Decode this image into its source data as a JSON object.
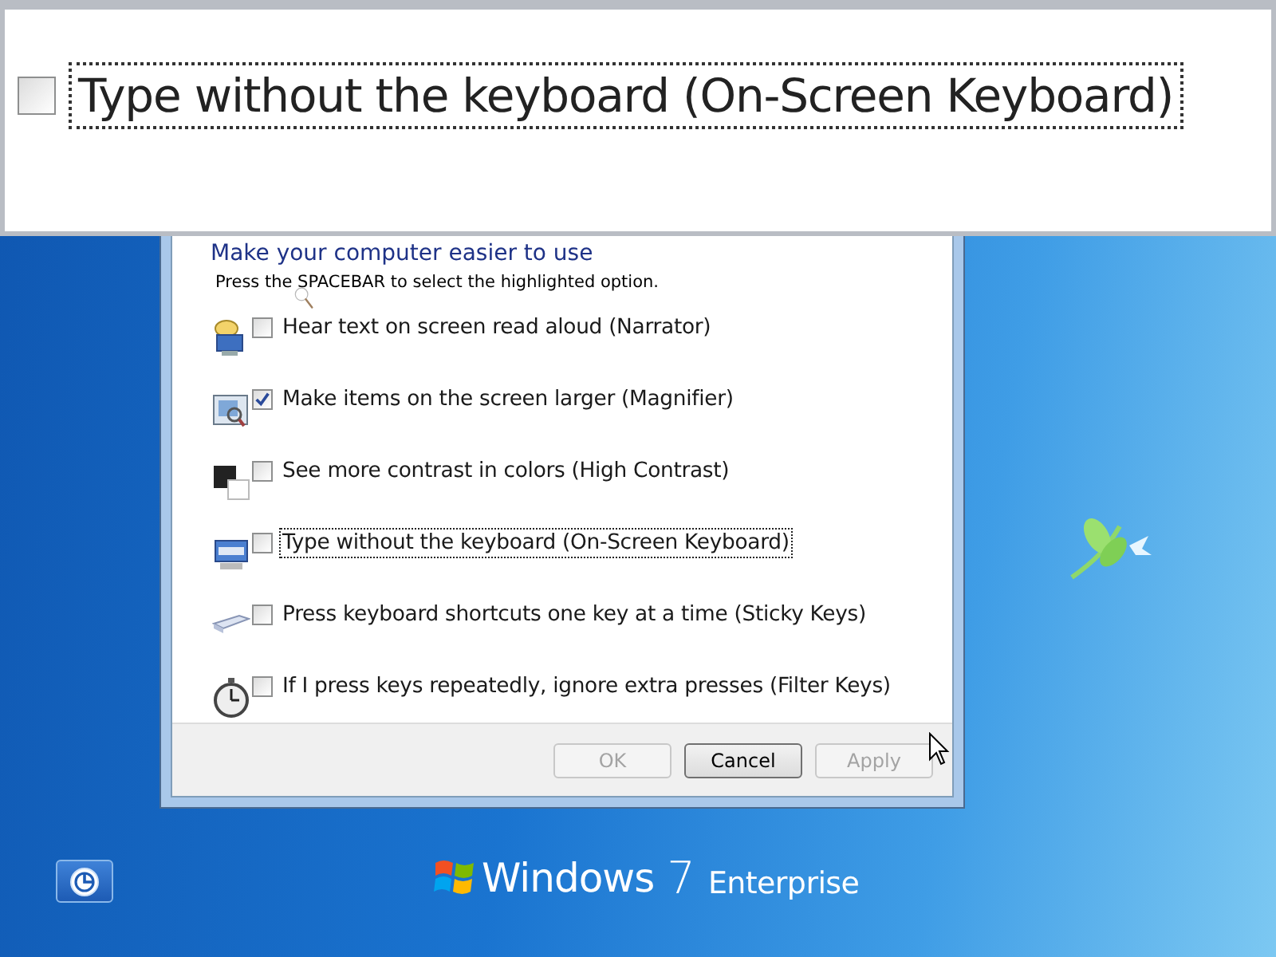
{
  "magnifier_view": {
    "option": {
      "label": "Type without the keyboard (On-Screen Keyboard)",
      "checked": false,
      "focused": true
    }
  },
  "dialog": {
    "heading": "Make your computer easier to use",
    "instruction": "Press the SPACEBAR to select the highlighted option.",
    "options": [
      {
        "kind": "narrator",
        "label": "Hear text on screen read aloud (Narrator)",
        "checked": false,
        "focused": false
      },
      {
        "kind": "magnifier",
        "label": "Make items on the screen larger (Magnifier)",
        "checked": true,
        "focused": false
      },
      {
        "kind": "contrast",
        "label": "See more contrast in colors (High Contrast)",
        "checked": false,
        "focused": false
      },
      {
        "kind": "keyboard",
        "label": "Type without the keyboard (On-Screen Keyboard)",
        "checked": false,
        "focused": true
      },
      {
        "kind": "sticky",
        "label": "Press keyboard shortcuts one key at a time (Sticky Keys)",
        "checked": false,
        "focused": false
      },
      {
        "kind": "filter",
        "label": "If I press keys repeatedly, ignore extra presses (Filter Keys)",
        "checked": false,
        "focused": false
      }
    ],
    "buttons": [
      {
        "label": "OK",
        "disabled": true
      },
      {
        "label": "Cancel",
        "disabled": false
      },
      {
        "label": "Apply",
        "disabled": true
      }
    ]
  },
  "branding": {
    "product": "Windows",
    "version": "7",
    "edition": "Enterprise"
  }
}
